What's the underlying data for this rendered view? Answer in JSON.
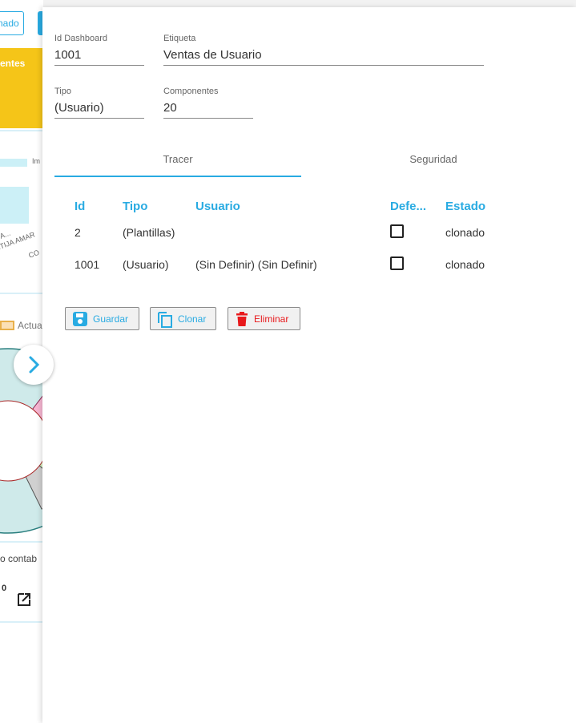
{
  "background": {
    "top_button_label": "nado",
    "yellow_card_label": "entes",
    "chart_tick_1": "Im",
    "chart_tick_2": "A...",
    "chart_tick_3": "RTIJA AMAR",
    "chart_tick_4": "CO",
    "legend_label": "Actua",
    "footer_text": "o contab",
    "badge_text": "0",
    "colors": {
      "accent": "#29abe2",
      "yellow": "#f5c518"
    }
  },
  "form": {
    "id_label": "Id Dashboard",
    "id_value": "1001",
    "etiqueta_label": "Etiqueta",
    "etiqueta_value": "Ventas de Usuario",
    "tipo_label": "Tipo",
    "tipo_value": "(Usuario)",
    "componentes_label": "Componentes",
    "componentes_value": "20"
  },
  "tabs": [
    {
      "label": "Tracer",
      "active": true
    },
    {
      "label": "Seguridad",
      "active": false
    }
  ],
  "table": {
    "headers": [
      "Id",
      "Tipo",
      "Usuario",
      "Defe...",
      "Estado"
    ],
    "rows": [
      {
        "id": "2",
        "tipo": "(Plantillas)",
        "usuario": "",
        "defecto": false,
        "estado": "clonado"
      },
      {
        "id": "1001",
        "tipo": "(Usuario)",
        "usuario": "(Sin Definir) (Sin Definir)",
        "defecto": false,
        "estado": "clonado"
      }
    ]
  },
  "actions": {
    "save_label": "Guardar",
    "clone_label": "Clonar",
    "delete_label": "Eliminar",
    "save_icon": "save-icon",
    "clone_icon": "copy-icon",
    "delete_icon": "trash-icon",
    "delete_color": "#e8191c"
  }
}
